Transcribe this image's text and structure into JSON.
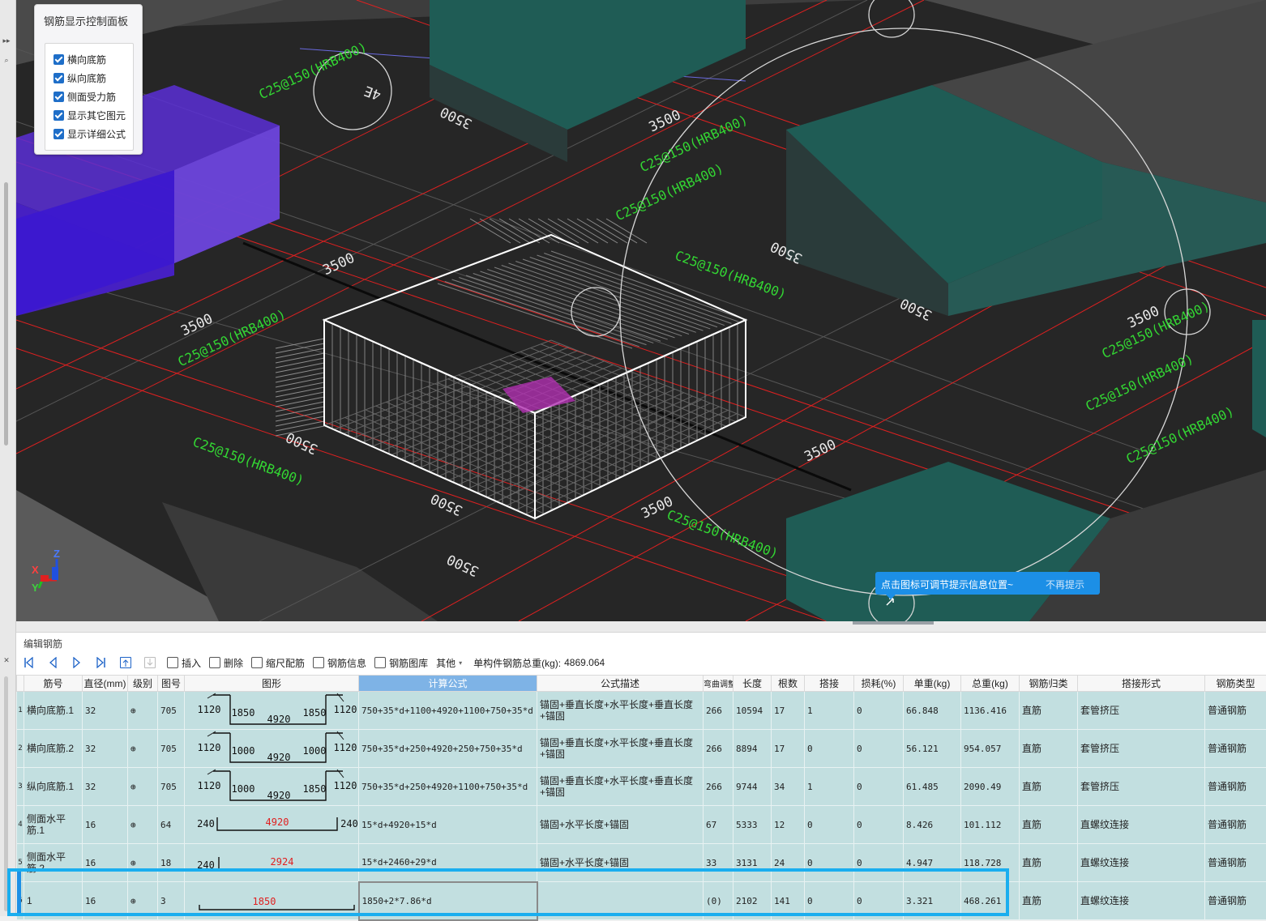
{
  "control_panel": {
    "title": "钢筋显示控制面板",
    "options": [
      {
        "label": "横向底筋",
        "checked": true
      },
      {
        "label": "纵向底筋",
        "checked": true
      },
      {
        "label": "侧面受力筋",
        "checked": true
      },
      {
        "label": "显示其它图元",
        "checked": true
      },
      {
        "label": "显示详细公式",
        "checked": true
      }
    ]
  },
  "viewport": {
    "dim_labels": [
      "3500",
      "3500",
      "3500",
      "3500",
      "3500",
      "3500",
      "3500",
      "3500",
      "3500",
      "3500",
      "3500",
      "3500"
    ],
    "rebar_labels": [
      "C25@150(HRB400)",
      "C25@150(HRB400)",
      "C25@150(HRB400)",
      "C25@150(HRB400)",
      "C25@150(HRB400)",
      "C25@150(HRB400)",
      "C25@150(HRB400)",
      "C25@150(HRB400)",
      "C25@150(HRB400)",
      "C25@150(HRB400)"
    ],
    "axis": {
      "x": "X",
      "y": "Y",
      "z": "Z"
    },
    "gizmo_label": "4E"
  },
  "tooltip": {
    "message": "点击图标可调节提示信息位置~",
    "dismiss": "不再提示"
  },
  "edit_panel": {
    "title": "编辑钢筋",
    "toolbar": {
      "insert": "插入",
      "delete": "删除",
      "scale": "缩尺配筋",
      "info": "钢筋信息",
      "library": "钢筋图库",
      "other": "其他",
      "total_weight_label": "单构件钢筋总重(kg):",
      "total_weight_value": "4869.064"
    },
    "columns": [
      "筋号",
      "直径(mm)",
      "级别",
      "图号",
      "图形",
      "计算公式",
      "公式描述",
      "弯曲调整",
      "长度",
      "根数",
      "搭接",
      "损耗(%)",
      "单重(kg)",
      "总重(kg)",
      "钢筋归类",
      "搭接形式",
      "钢筋类型"
    ],
    "grade_symbol": "⊕",
    "rows": [
      {
        "no": "1",
        "name": "横向底筋.1",
        "dia": "32",
        "fig_no": "705",
        "fig": {
          "a": "1120",
          "b": "1850",
          "c": "4920",
          "d": "1850",
          "e": "1120"
        },
        "formula": "750+35*d+1100+4920+1100+750+35*d",
        "desc": "锚固+垂直长度+水平长度+垂直长度+锚固",
        "bend": "266",
        "length": "10594",
        "count": "17",
        "lap": "1",
        "loss": "0",
        "unit_w": "66.848",
        "total_w": "1136.416",
        "category": "直筋",
        "lap_form": "套管挤压",
        "type": "普通钢筋"
      },
      {
        "no": "2",
        "name": "横向底筋.2",
        "dia": "32",
        "fig_no": "705",
        "fig": {
          "a": "1120",
          "b": "1000",
          "c": "4920",
          "d": "1000",
          "e": "1120"
        },
        "formula": "750+35*d+250+4920+250+750+35*d",
        "desc": "锚固+垂直长度+水平长度+垂直长度+锚固",
        "bend": "266",
        "length": "8894",
        "count": "17",
        "lap": "0",
        "loss": "0",
        "unit_w": "56.121",
        "total_w": "954.057",
        "category": "直筋",
        "lap_form": "套管挤压",
        "type": "普通钢筋"
      },
      {
        "no": "3",
        "name": "纵向底筋.1",
        "dia": "32",
        "fig_no": "705",
        "fig": {
          "a": "1120",
          "b": "1000",
          "c": "4920",
          "d": "1850",
          "e": "1120"
        },
        "formula": "750+35*d+250+4920+1100+750+35*d",
        "desc": "锚固+垂直长度+水平长度+垂直长度+锚固",
        "bend": "266",
        "length": "9744",
        "count": "34",
        "lap": "1",
        "loss": "0",
        "unit_w": "61.485",
        "total_w": "2090.49",
        "category": "直筋",
        "lap_form": "套管挤压",
        "type": "普通钢筋"
      },
      {
        "no": "4",
        "name": "侧面水平筋.1",
        "dia": "16",
        "fig_no": "64",
        "fig": {
          "a": "240",
          "c": "4920",
          "e": "240"
        },
        "formula": "15*d+4920+15*d",
        "desc": "锚固+水平长度+锚固",
        "bend": "67",
        "length": "5333",
        "count": "12",
        "lap": "0",
        "loss": "0",
        "unit_w": "8.426",
        "total_w": "101.112",
        "category": "直筋",
        "lap_form": "直螺纹连接",
        "type": "普通钢筋"
      },
      {
        "no": "5",
        "name": "侧面水平筋.2",
        "dia": "16",
        "fig_no": "18",
        "fig": {
          "a": "240",
          "c": "2924"
        },
        "formula": "15*d+2460+29*d",
        "desc": "锚固+水平长度+锚固",
        "bend": "33",
        "length": "3131",
        "count": "24",
        "lap": "0",
        "loss": "0",
        "unit_w": "4.947",
        "total_w": "118.728",
        "category": "直筋",
        "lap_form": "直螺纹连接",
        "type": "普通钢筋"
      },
      {
        "no": "6",
        "name": "1",
        "dia": "16",
        "fig_no": "3",
        "fig": {
          "c": "1850"
        },
        "formula": "1850+2*7.86*d",
        "desc": "",
        "bend": "(0)",
        "length": "2102",
        "count": "141",
        "lap": "0",
        "loss": "0",
        "unit_w": "3.321",
        "total_w": "468.261",
        "category": "直筋",
        "lap_form": "直螺纹连接",
        "type": "普通钢筋"
      }
    ]
  },
  "colors": {
    "accent": "#1c8fe6",
    "selection": "#1aaeef",
    "row_bg": "#c2dfe0",
    "red_dim": "#e02020",
    "green_text": "#33d633"
  }
}
